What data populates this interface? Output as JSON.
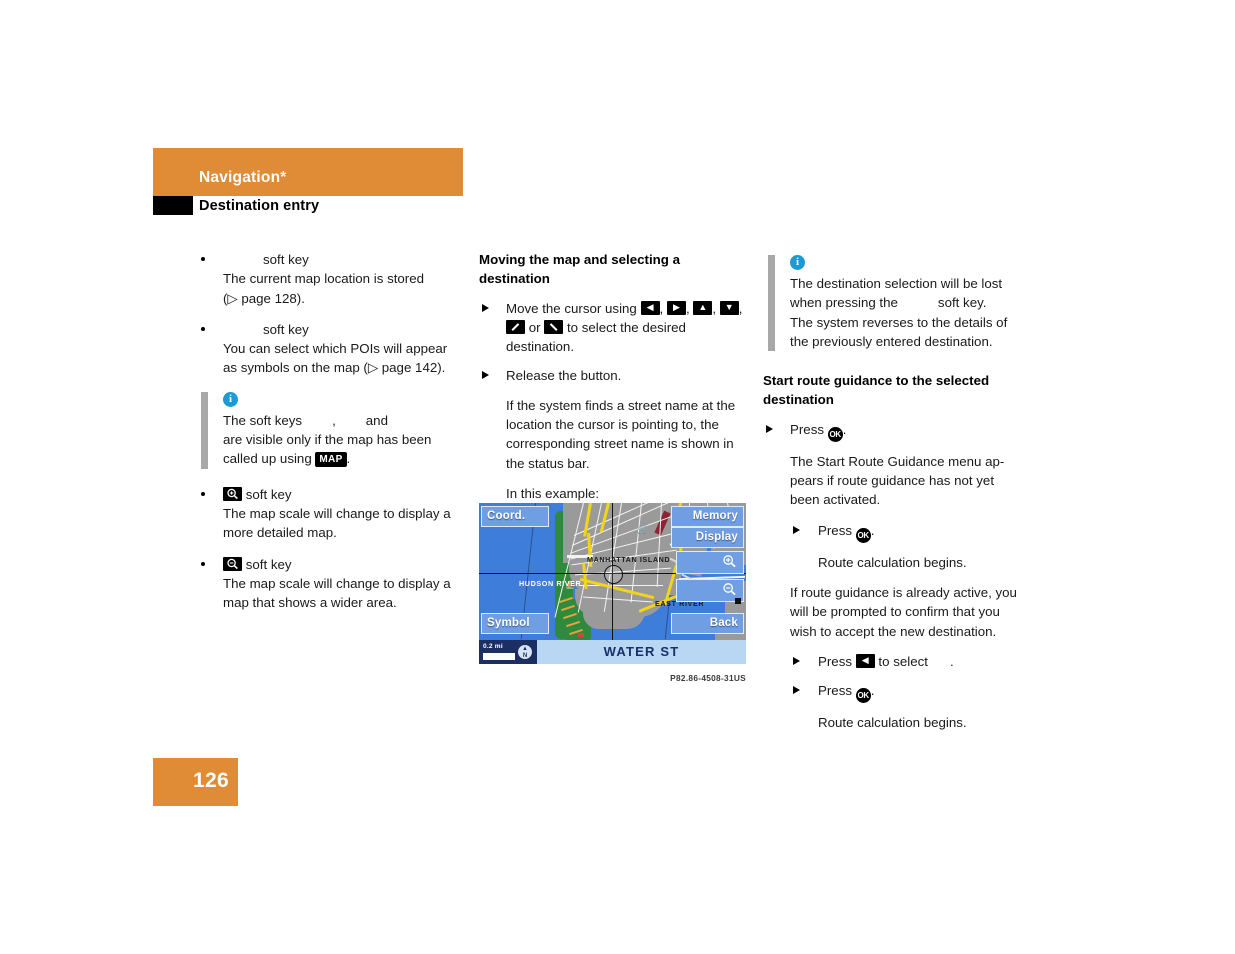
{
  "header": {
    "chapter": "Navigation*",
    "section": "Destination entry"
  },
  "page_number": "126",
  "left_column": {
    "bullets": [
      {
        "key_label": "",
        "key_suffix": "soft key",
        "body_lines": [
          "The current map location is stored",
          "(▷ page 128)."
        ]
      },
      {
        "key_label": "",
        "key_suffix": "soft key",
        "body_lines": [
          "You can select which POIs will appear",
          "as symbols on the map (▷ page 142)."
        ]
      }
    ],
    "note": {
      "icon": "info-icon",
      "line1_a": "The soft keys",
      "line1_b": ",",
      "line1_c": "and",
      "line2": "are visible only if the map has been",
      "line3_a": "called up using",
      "map_button": "MAP",
      "line3_b": "."
    },
    "zoom_bullets": [
      {
        "icon": "magnifier-plus-icon",
        "key_suffix": "soft key",
        "body_lines": [
          "The map scale will change to display a",
          "more detailed map."
        ]
      },
      {
        "icon": "magnifier-minus-icon",
        "key_suffix": "soft key",
        "body_lines": [
          "The map scale will change to display a",
          "map that shows a wider area."
        ]
      }
    ]
  },
  "middle_column": {
    "heading": "Moving the map and selecting a destination",
    "step1": {
      "text_a": "Move the cursor using",
      "keys": [
        "arrow-left-icon",
        "arrow-right-icon",
        "arrow-up-icon",
        "arrow-down-icon",
        "arrow-diag-up-icon",
        "arrow-diag-down-icon"
      ],
      "text_or": "or",
      "text_b": "to select the desired",
      "text_c": "destination."
    },
    "step2": "Release the button.",
    "body_lines": [
      "If the system finds a street name at the",
      "location the cursor is pointing to, the",
      "corresponding street name is shown in",
      "the status bar."
    ],
    "example_label": "In this example:",
    "figure": {
      "caption": "P82.86-4508-31US",
      "softkeys_left": [
        "Coord.",
        "Symbol"
      ],
      "softkeys_right": [
        "Memory",
        "Display",
        "Back"
      ],
      "softkey_zoom_in": "zoom-in-icon",
      "softkey_zoom_out": "zoom-out-icon",
      "map_labels": [
        "MANHATTAN ISLAND",
        "HUDSON RIVER",
        "EAST RIVER"
      ],
      "status_street": "WATER ST",
      "scale_value": "0.2 mi",
      "compass": "N"
    }
  },
  "right_column": {
    "note": {
      "icon": "info-icon",
      "line1": "The destination selection will be lost",
      "line2_a": "when pressing the",
      "line2_b": "soft key.",
      "line3": "The system reverses to the details of",
      "line4": "the previously entered destination."
    },
    "heading": "Start route guidance to the selected destination",
    "step1_a": "Press",
    "step1_key": "ok-button-icon",
    "step1_b": ".",
    "body1_lines": [
      "The Start Route Guidance menu ap-",
      "pears if route guidance has not yet",
      "been activated."
    ],
    "step2_a": "Press",
    "step2_key": "ok-button-icon",
    "step2_b": ".",
    "body2": "Route calculation begins.",
    "body3_lines": [
      "If route guidance is already active, you",
      "will be prompted to confirm that you",
      "wish to accept the new destination."
    ],
    "step3_a": "Press",
    "step3_key": "arrow-left-icon",
    "step3_b": "to select",
    "step3_target": "",
    "step3_c": ".",
    "step4_a": "Press",
    "step4_key": "ok-button-icon",
    "step4_b": ".",
    "body4": "Route calculation begins."
  },
  "colors": {
    "accent_orange": "#e08b36",
    "info_blue": "#1b9ad6",
    "note_rail_gray": "#a8a8a8",
    "map_water": "#3f7ddb",
    "map_land": "#9a9a9a",
    "map_road_yellow": "#f2d41a",
    "softkey_blue": "#6f9ee3",
    "status_bar": "#b9d6f2"
  }
}
